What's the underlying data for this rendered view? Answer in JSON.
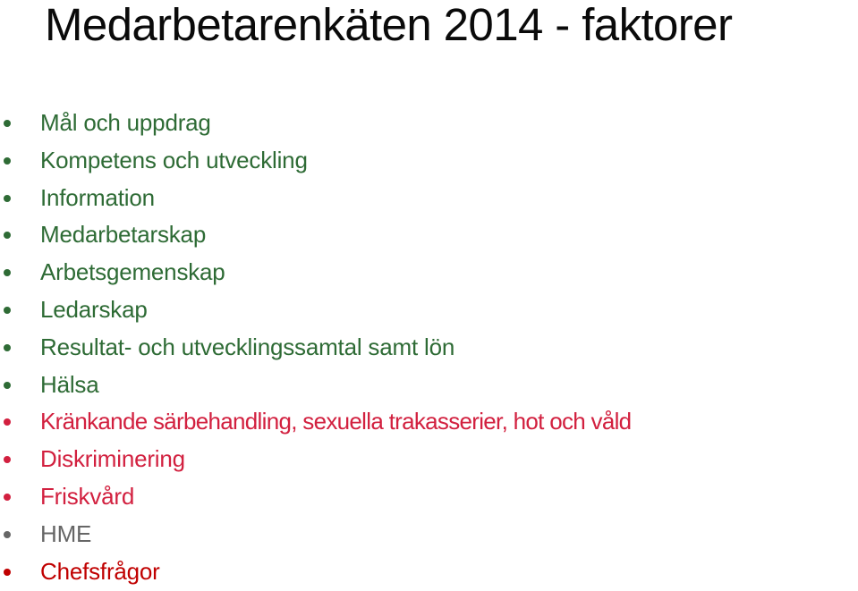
{
  "slide": {
    "title": "Medarbetarenkäten 2014 - faktorer",
    "colors": {
      "title": "#0a0a0a",
      "green": "#2e6b35",
      "crimson": "#d2203f",
      "gray": "#666666",
      "darkred": "#c00000"
    },
    "items": [
      {
        "label": "Mål och uppdrag",
        "color": "green"
      },
      {
        "label": "Kompetens och utveckling",
        "color": "green"
      },
      {
        "label": "Information",
        "color": "green"
      },
      {
        "label": "Medarbetarskap",
        "color": "green"
      },
      {
        "label": "Arbetsgemenskap",
        "color": "green"
      },
      {
        "label": "Ledarskap",
        "color": "green"
      },
      {
        "label": "Resultat- och utvecklingssamtal samt lön",
        "color": "green"
      },
      {
        "label": "Hälsa",
        "color": "green"
      },
      {
        "label": "Kränkande särbehandling, sexuella trakasserier, hot och våld",
        "color": "crimson"
      },
      {
        "label": "Diskriminering",
        "color": "crimson"
      },
      {
        "label": "Friskvård",
        "color": "crimson"
      },
      {
        "label": "HME",
        "color": "gray"
      },
      {
        "label": "Chefsfrågor",
        "color": "darkred"
      }
    ]
  }
}
